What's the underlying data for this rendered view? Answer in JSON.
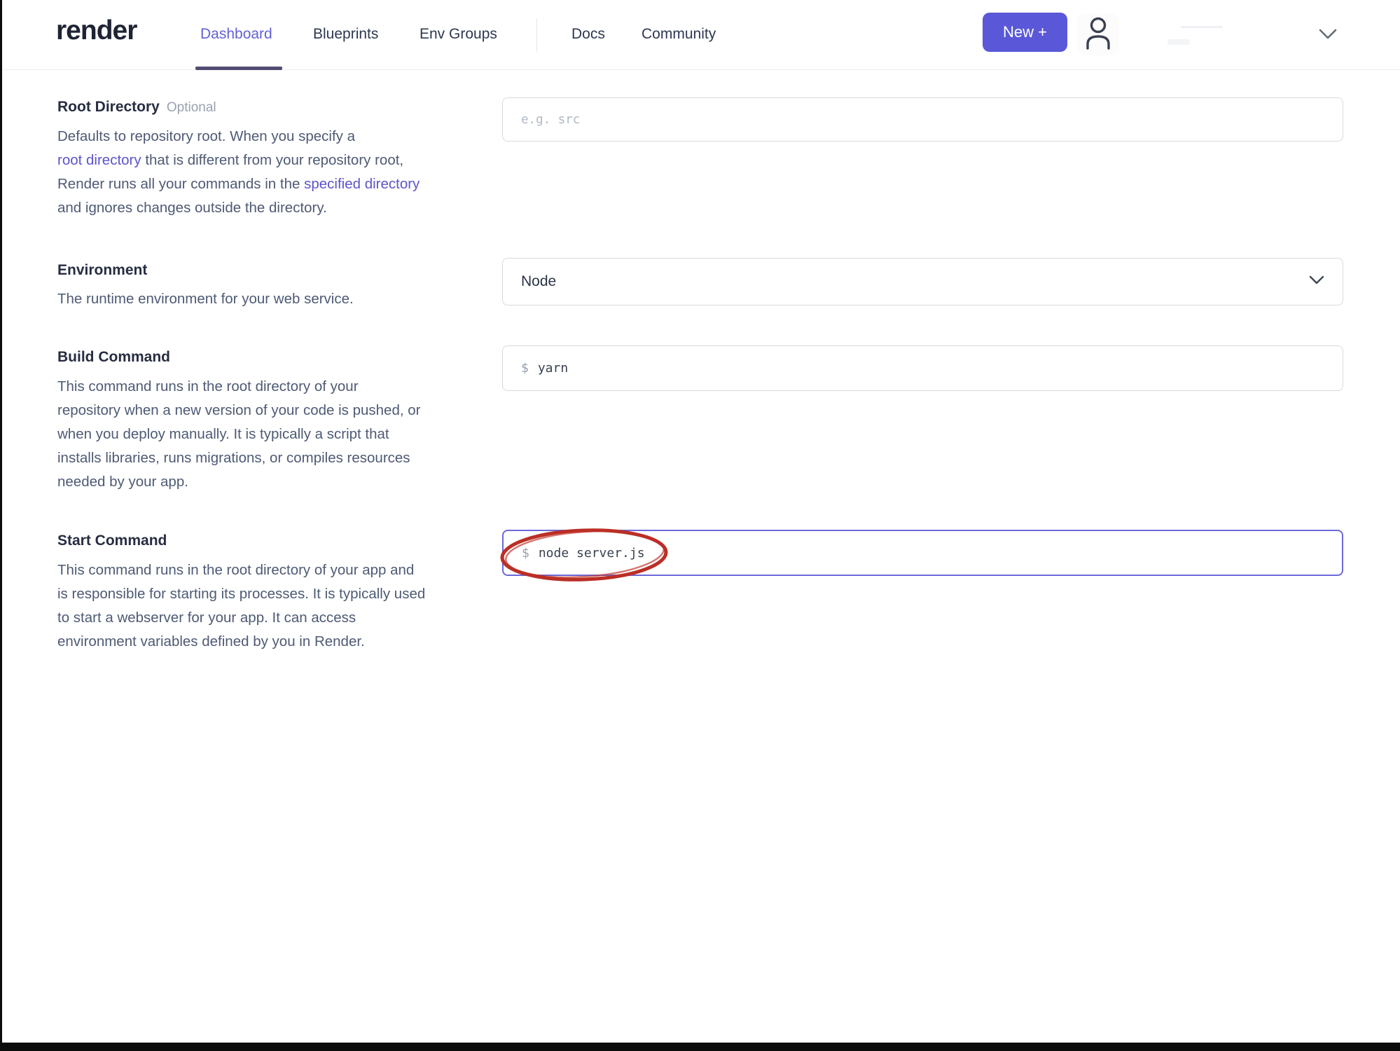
{
  "colors": {
    "accent": "#5a58d8",
    "active_tab": "#6461d4",
    "link": "#5d55cb",
    "focus_border": "#6c68da",
    "annotation": "#bb2f26"
  },
  "header": {
    "logo": "render",
    "nav": [
      {
        "label": "Dashboard",
        "active": true
      },
      {
        "label": "Blueprints",
        "active": false
      },
      {
        "label": "Env Groups",
        "active": false
      }
    ],
    "nav_secondary": [
      {
        "label": "Docs"
      },
      {
        "label": "Community"
      }
    ],
    "new_button_label": "New +",
    "icons": {
      "user": "user-outline-icon",
      "chevron": "chevron-down-icon"
    }
  },
  "form": {
    "sections": [
      {
        "label": "Root Directory",
        "badge": "Optional",
        "description": [
          [
            {
              "t": "Defaults to repository root. When you specify a"
            }
          ],
          [
            {
              "t": "root directory",
              "link": true
            },
            {
              "t": " that is different from your repository root,"
            }
          ],
          [
            {
              "t": "Render runs all your commands in the "
            },
            {
              "t": "specified directory",
              "link": true
            }
          ],
          [
            {
              "t": "and ignores changes outside the directory."
            }
          ]
        ],
        "input": {
          "placeholder": "e.g. src"
        }
      },
      {
        "label": "Environment",
        "badge": "",
        "description": [
          [
            {
              "t": "The runtime environment for your web service."
            }
          ]
        ],
        "select": {
          "value": "Node"
        }
      },
      {
        "label": "Build Command",
        "badge": "",
        "description": [
          [
            {
              "t": "This command runs in the root directory of your"
            }
          ],
          [
            {
              "t": "repository when a new version of your code is pushed, or"
            }
          ],
          [
            {
              "t": "when you deploy manually. It is typically a script that"
            }
          ],
          [
            {
              "t": "installs libraries, runs migrations, or compiles resources"
            }
          ],
          [
            {
              "t": "needed by your app."
            }
          ]
        ],
        "input": {
          "prefix": "$",
          "value": "yarn"
        }
      },
      {
        "label": "Start Command",
        "badge": "",
        "description": [
          [
            {
              "t": "This command runs in the root directory of your app and"
            }
          ],
          [
            {
              "t": "is responsible for starting its processes. It is typically used"
            }
          ],
          [
            {
              "t": "to start a webserver for your app. It can access"
            }
          ],
          [
            {
              "t": "environment variables defined by you in Render."
            }
          ]
        ],
        "input": {
          "prefix": "$",
          "value": "node server.js",
          "focused": true,
          "annotated": true
        }
      }
    ]
  }
}
